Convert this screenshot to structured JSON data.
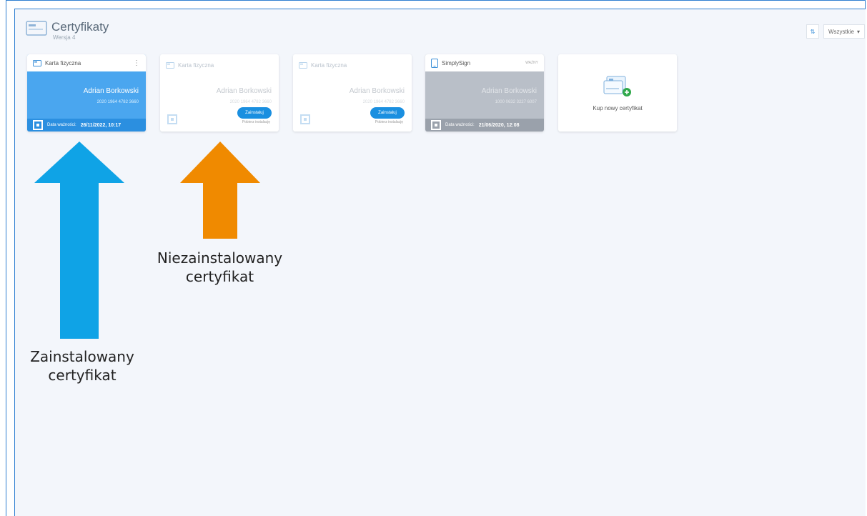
{
  "header": {
    "title": "Certyfikaty",
    "subtitle": "Wersja 4"
  },
  "filter": {
    "sort_icon": "sort-icon",
    "selected": "Wszystkie",
    "chevron": "▾"
  },
  "cards": [
    {
      "type": "Karta fizyczna",
      "name": "Adrian Borkowski",
      "number": "2020 1964 4782 3660",
      "validity_label": "Data ważności:",
      "validity_value": "26/11/2022, 10:17",
      "menu": "⋮"
    },
    {
      "type": "Karta fizyczna",
      "name": "Adrian Borkowski",
      "number": "2020 1964 4782 3660",
      "install_label": "Zainstaluj",
      "install_sub": "Pobierz instalację"
    },
    {
      "type": "Karta fizyczna",
      "name": "Adrian Borkowski",
      "number": "2020 1964 4782 3660",
      "install_label": "Zainstaluj",
      "install_sub": "Pobierz instalację"
    },
    {
      "type": "SimplySign",
      "badge": "WAŻNY",
      "name": "Adrian Borkowski",
      "number": "1000 0632 3227 6007",
      "validity_label": "Data ważności:",
      "validity_value": "21/06/2020, 12:08"
    },
    {
      "label": "Kup nowy certyfikat"
    }
  ],
  "annotations": {
    "installed": [
      "Zainstalowany",
      "certyfikat"
    ],
    "not_installed": [
      "Niezainstalowany",
      "certyfikat"
    ],
    "installed_color": "#0fa3e6",
    "not_installed_color": "#f08a00"
  }
}
